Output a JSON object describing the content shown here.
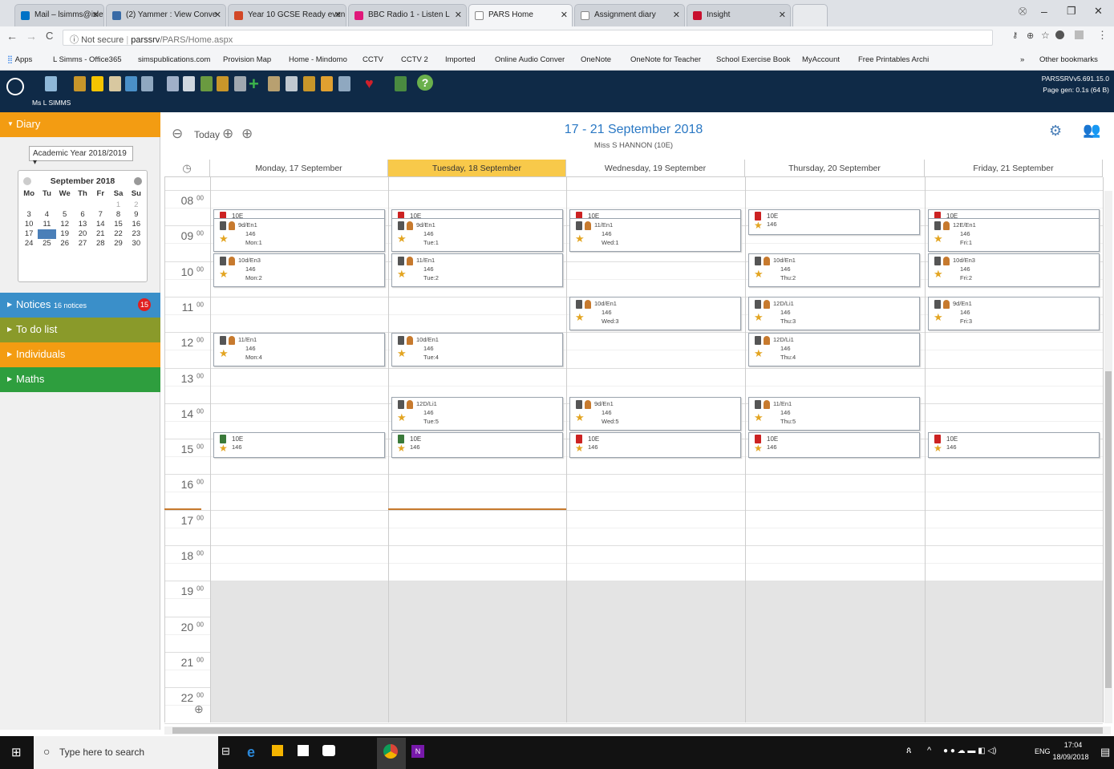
{
  "browser": {
    "tabs": [
      {
        "label": "Mail – lsimms@isleworth",
        "color": "#0072c6"
      },
      {
        "label": "(2) Yammer : View Conve",
        "color": "#396ba6"
      },
      {
        "label": "Year 10 GCSE Ready even",
        "color": "#d24726"
      },
      {
        "label": "BBC Radio 1 - Listen L",
        "color": "#e0187a"
      },
      {
        "label": "PARS Home",
        "color": "#888888"
      },
      {
        "label": "Assignment diary",
        "color": "#888888"
      },
      {
        "label": "Insight",
        "color": "#c8102e"
      }
    ],
    "security": "Not secure",
    "url_host": "parssrv",
    "url_path": "/PARS/Home.aspx",
    "bookmarks": [
      "Apps",
      "L Simms - Office365",
      "simspublications.com",
      "Provision Map",
      "Home - Mindomo",
      "CCTV",
      "CCTV 2",
      "Imported",
      "Online Audio Conver",
      "OneNote",
      "OneNote for Teacher",
      "School Exercise Book",
      "MyAccount",
      "Free Printables Archi"
    ],
    "other_bookmarks": "Other bookmarks"
  },
  "app": {
    "user": "Ms L SIMMS",
    "version": "PARSSRVv5.691.15.0",
    "page_gen": "Page gen: 0.1s (64 B)"
  },
  "sidebar": {
    "diary": "Diary",
    "academic_year": "Academic Year 2018/2019",
    "calendar_month": "September 2018",
    "weekdays": [
      "Mo",
      "Tu",
      "We",
      "Th",
      "Fr",
      "Sa",
      "Su"
    ],
    "weeks": [
      [
        "",
        "",
        "",
        "",
        "",
        "1",
        "2"
      ],
      [
        "3",
        "4",
        "5",
        "6",
        "7",
        "8",
        "9"
      ],
      [
        "10",
        "11",
        "12",
        "13",
        "14",
        "15",
        "16"
      ],
      [
        "17",
        "18",
        "19",
        "20",
        "21",
        "22",
        "23"
      ],
      [
        "24",
        "25",
        "26",
        "27",
        "28",
        "29",
        "30"
      ]
    ],
    "notices": "Notices",
    "notices_count": "16 notices",
    "notices_badge": "15",
    "todo": "To do list",
    "individuals": "Individuals",
    "maths": "Maths"
  },
  "diary": {
    "today": "Today",
    "range": "17 - 21 September 2018",
    "subtitle": "Miss S HANNON (10E)",
    "days": [
      "Monday, 17 September",
      "Tuesday, 18 September",
      "Wednesday, 19 September",
      "Thursday, 20 September",
      "Friday, 21 September"
    ],
    "hours": [
      "08",
      "09",
      "10",
      "11",
      "12",
      "13",
      "14",
      "15",
      "16",
      "17",
      "18",
      "19",
      "20",
      "21",
      "22"
    ],
    "minutes": "00"
  },
  "taskbar": {
    "search": "Type here to search",
    "lang": "ENG",
    "time": "17:04",
    "date": "18/09/2018"
  }
}
